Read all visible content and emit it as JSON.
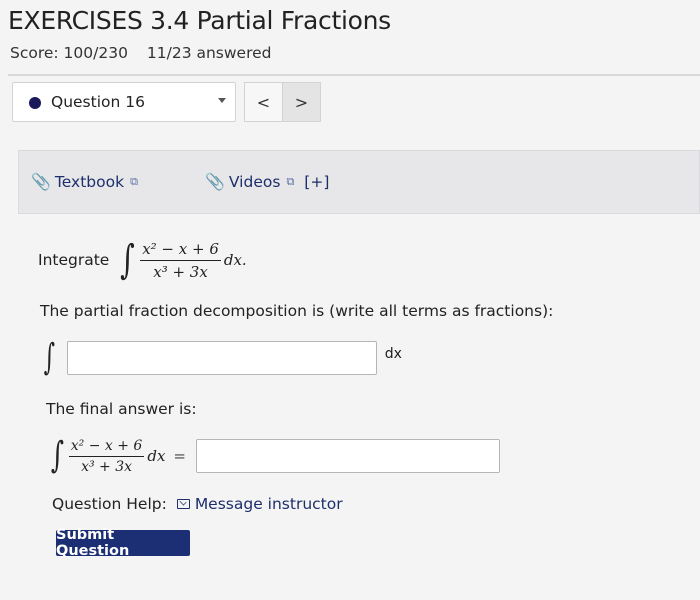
{
  "header": {
    "title": "EXERCISES 3.4 Partial Fractions",
    "score": "Score: 100/230",
    "answered": "11/23 answered"
  },
  "question_nav": {
    "selected": "Question 16",
    "prev_label": "<",
    "next_label": ">"
  },
  "resources": {
    "textbook_label": "Textbook",
    "videos_label": "Videos",
    "videos_expand": "[+]"
  },
  "problem": {
    "integrate_label": "Integrate",
    "numerator": "x² − x + 6",
    "denominator": "x³ + 3x",
    "dx": "dx.",
    "pfd_prompt": "The partial fraction decomposition is (write all terms as fractions):",
    "pfd_dx": "dx",
    "final_prompt": "The final answer is:",
    "final_dx": "dx",
    "equals": "="
  },
  "inputs": {
    "pfd_value": "",
    "final_value": ""
  },
  "help": {
    "label": "Question Help:",
    "message_instructor": "Message instructor"
  },
  "submit_label": "Submit Question",
  "colors": {
    "accent": "#1c2f74",
    "link": "#1d2f6b",
    "resource_bar": "#e7e7e9"
  }
}
